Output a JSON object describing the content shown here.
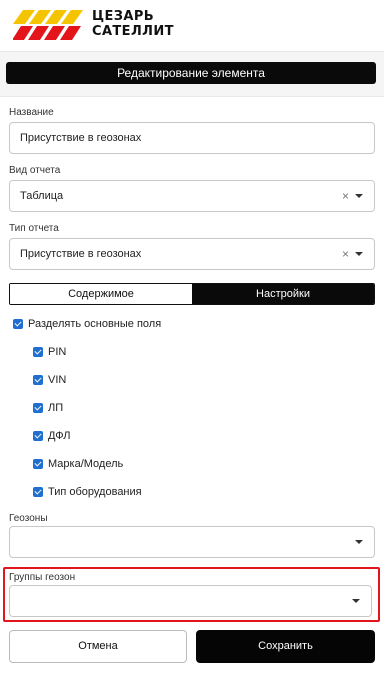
{
  "brand": {
    "line1": "ЦЕЗАРЬ",
    "line2": "САТЕЛЛИТ",
    "accent_color": "#f5c400",
    "secondary_color": "#e3151a"
  },
  "title": "Редактирование элемента",
  "fields": {
    "name": {
      "label": "Название",
      "value": "Присутствие в геозонах"
    },
    "report_view": {
      "label": "Вид отчета",
      "value": "Таблица",
      "clear": "×"
    },
    "report_type": {
      "label": "Тип отчета",
      "value": "Присутствие в геозонах",
      "clear": "×"
    }
  },
  "tabs": [
    {
      "label": "Содержимое",
      "active": false
    },
    {
      "label": "Настройки",
      "active": true
    }
  ],
  "settings": {
    "split_fields": {
      "label": "Разделять основные поля",
      "checked": true
    },
    "items": [
      {
        "label": "PIN",
        "checked": true
      },
      {
        "label": "VIN",
        "checked": true
      },
      {
        "label": "ЛП",
        "checked": true
      },
      {
        "label": "ДФЛ",
        "checked": true
      },
      {
        "label": "Марка/Модель",
        "checked": true
      },
      {
        "label": "Тип оборудования",
        "checked": true
      }
    ]
  },
  "geozones": {
    "label": "Геозоны",
    "value": ""
  },
  "geozone_groups": {
    "label": "Группы геозон",
    "value": ""
  },
  "buttons": {
    "cancel": "Отмена",
    "save": "Сохранить"
  }
}
